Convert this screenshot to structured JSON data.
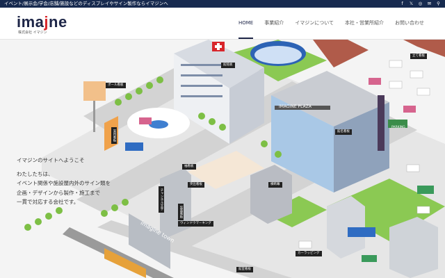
{
  "topbar": {
    "tagline": "イベント/展示会/学会/店舗/施設などのディスプレイやサイン製作ならイマジンへ",
    "social": [
      "facebook-icon",
      "x-icon",
      "instagram-icon",
      "mail-icon",
      "search-icon"
    ]
  },
  "logo": {
    "word_a": "ima",
    "word_j": "j",
    "word_b": "ne",
    "sub": "株式会社 イマジン"
  },
  "nav": {
    "items": [
      {
        "label": "HOME",
        "active": true
      },
      {
        "label": "事業紹介"
      },
      {
        "label": "イマジンについて"
      },
      {
        "label": "本社・営業所紹介"
      },
      {
        "label": "お問い合わせ"
      }
    ]
  },
  "intro": {
    "greeting": "イマジンのサイトへようこそ",
    "lines": [
      "わたしたちは、",
      "イベント関係や施設屋内外のサイン類を",
      "企画・デザインから製作・施工まで",
      "一貫で対応する会社です。"
    ]
  },
  "scene": {
    "labels": [
      "ポール看板",
      "案内看板",
      "館銘板",
      "IMAGINE PLAZA",
      "館名看板",
      "PARKING",
      "立て看板",
      "袖看板",
      "チャンネル文字",
      "突出看板",
      "横断幕",
      "窓面看板",
      "ウィンドウマーキング",
      "カーラッピング",
      "館室看板",
      "imagine town"
    ],
    "colors": {
      "road": "#d6d6d6",
      "green": "#7fc44a",
      "sky": "#f4f4f4",
      "navy": "#172a4f",
      "accent": "#d8252b"
    }
  }
}
